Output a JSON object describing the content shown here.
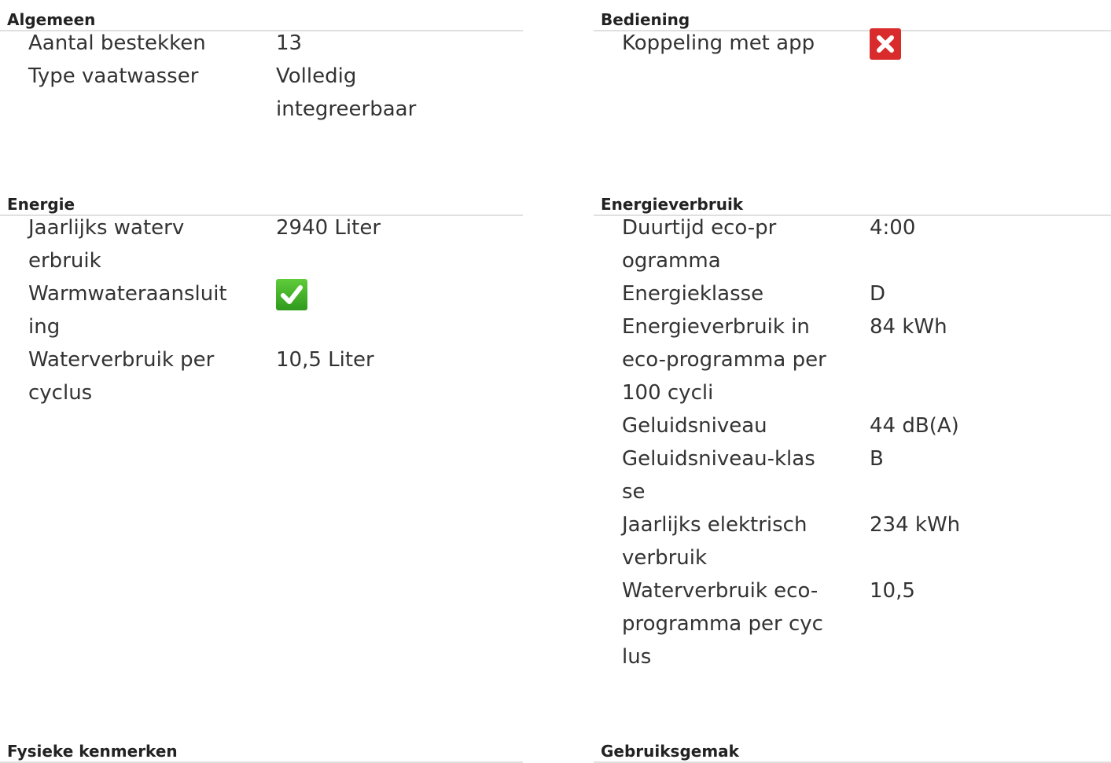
{
  "sections": {
    "algemeen": {
      "title": "Algemeen",
      "rows": [
        {
          "label": "Aantal bestekken",
          "value": "13"
        },
        {
          "label": "Type vaatwasser",
          "value": "Volledig integreerbaar"
        }
      ]
    },
    "bediening": {
      "title": "Bediening",
      "rows": [
        {
          "label": "Koppeling met app",
          "icon": "cross-icon",
          "value_state": "no"
        }
      ]
    },
    "energie": {
      "title": "Energie",
      "rows": [
        {
          "label": "Jaarlijks waterverbruik",
          "value": "2940 Liter"
        },
        {
          "label": "Warmwateraansluiting",
          "icon": "checkmark-icon",
          "value_state": "yes"
        },
        {
          "label": "Waterverbruik per cyclus",
          "value": "10,5 Liter"
        }
      ]
    },
    "energieverbruik": {
      "title": "Energieverbruik",
      "rows": [
        {
          "label": "Duurtijd eco-programma",
          "value": "4:00"
        },
        {
          "label": "Energieklasse",
          "value": "D"
        },
        {
          "label": "Energieverbruik in eco-programma per 100 cycli",
          "value": "84 kWh"
        },
        {
          "label": "Geluidsniveau",
          "value": "44 dB(A)"
        },
        {
          "label": "Geluidsniveau-klasse",
          "value": "B"
        },
        {
          "label": "Jaarlijks elektrisch verbruik",
          "value": "234 kWh"
        },
        {
          "label": "Waterverbruik eco-programma per cyclus",
          "value": "10,5"
        }
      ]
    },
    "fysieke": {
      "title": "Fysieke kenmerken"
    },
    "gebruiksgemak": {
      "title": "Gebruiksgemak"
    }
  },
  "colors": {
    "cross": "#d92b2b",
    "check": "#3aa82a",
    "divider": "#e0e0e0"
  }
}
